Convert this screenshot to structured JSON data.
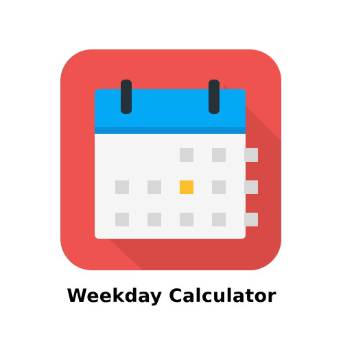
{
  "app": {
    "title": "Weekday Calculator",
    "icon": "calendar-icon"
  },
  "colors": {
    "tile_background": "#ef5350",
    "tile_shadow": "#d84a46",
    "calendar_header": "#03a9f4",
    "calendar_header_band": "#0a8ed8",
    "calendar_body": "#f5f5f5",
    "rings": "#263238",
    "day_cell": "#d7d7d7",
    "highlighted_day": "#fbc02d",
    "title_text": "#000000"
  },
  "calendar": {
    "rows": [
      [
        false,
        false,
        true,
        true,
        true
      ],
      [
        true,
        true,
        true,
        true,
        true
      ],
      [
        true,
        true,
        true,
        true,
        true
      ]
    ],
    "highlighted": {
      "row": 1,
      "col": 2
    }
  }
}
